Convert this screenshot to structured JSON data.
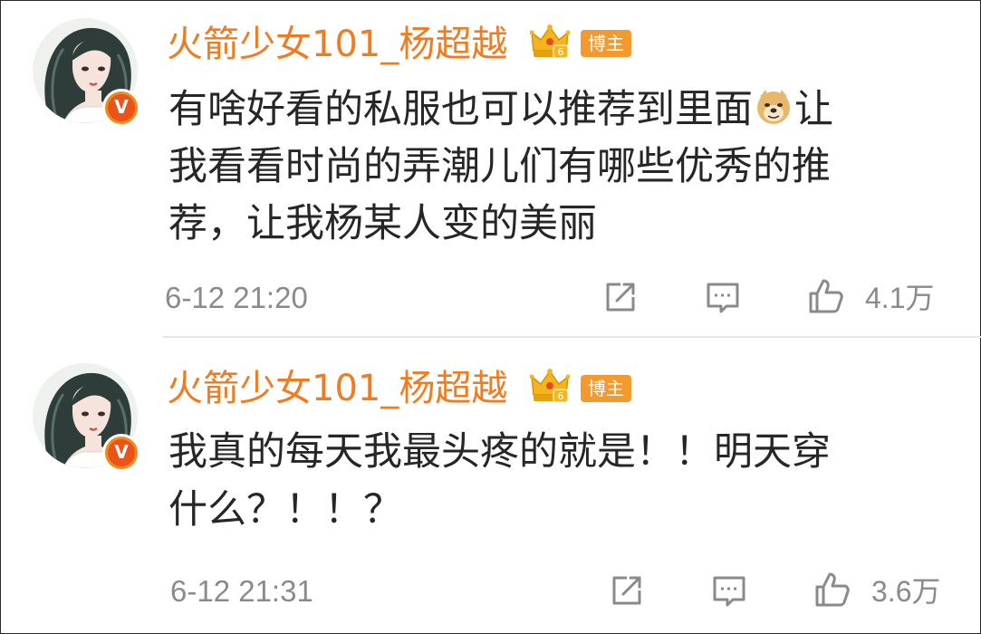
{
  "colors": {
    "username": "#ee7c22",
    "blogger_tag_bg": "#f29a2e",
    "text": "#262626",
    "meta": "#8a8a8a",
    "verified_badge": "#e8541a",
    "crown": "#f5b51c"
  },
  "comments": [
    {
      "username": "火箭少女101_杨超越",
      "crown_level": "6",
      "blogger_tag": "博主",
      "verified_badge": "V",
      "avatar_icon": "avatar-portrait",
      "text_lines": [
        "有啥好看的私服也可以推荐到里面",
        "让",
        "我看看时尚的弄潮儿们有哪些优秀的推",
        "荐，让我杨某人变的美丽"
      ],
      "emoji": "doge-emoji",
      "timestamp": "6-12 21:20",
      "likes": "4.1万",
      "icons": [
        "repost-icon",
        "comment-icon",
        "like-icon"
      ]
    },
    {
      "username": "火箭少女101_杨超越",
      "crown_level": "6",
      "blogger_tag": "博主",
      "verified_badge": "V",
      "avatar_icon": "avatar-portrait",
      "text_lines": [
        "我真的每天我最头疼的就是！！明天穿",
        "什么？！！？"
      ],
      "timestamp": "6-12 21:31",
      "likes": "3.6万",
      "icons": [
        "repost-icon",
        "comment-icon",
        "like-icon"
      ]
    }
  ]
}
